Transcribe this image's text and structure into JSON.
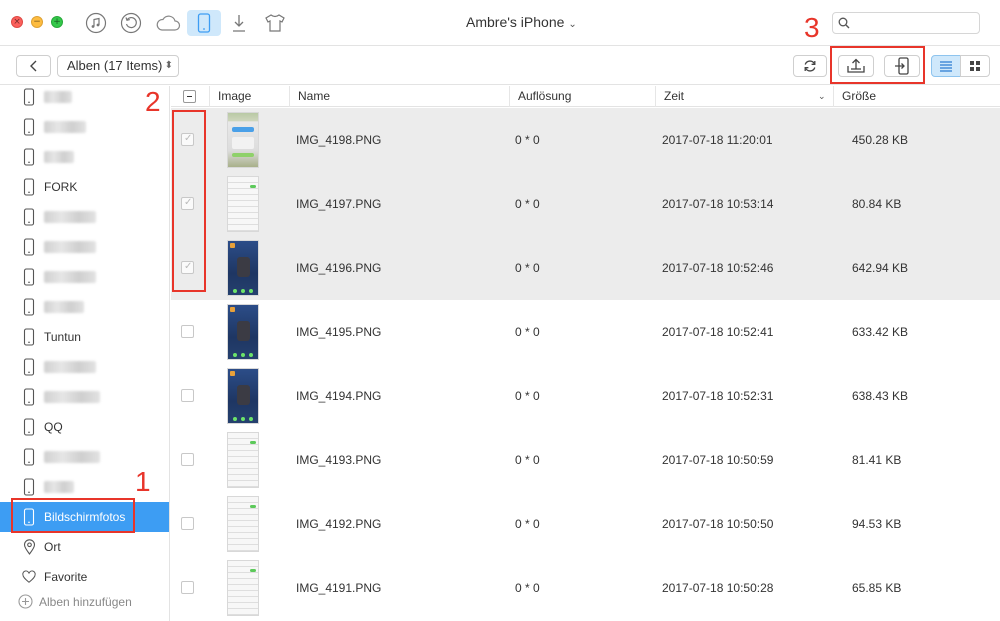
{
  "window": {
    "device_title": "Ambre's iPhone",
    "search_placeholder": ""
  },
  "toolbar": {
    "album_selector": "Alben (17 Items)"
  },
  "annotations": {
    "n1": "1",
    "n2": "2",
    "n3": "3"
  },
  "sidebar": {
    "items": [
      {
        "label": "",
        "blurred": true
      },
      {
        "label": "",
        "blurred": true
      },
      {
        "label": "",
        "blurred": true
      },
      {
        "label": "FORK",
        "blurred": false
      },
      {
        "label": "",
        "blurred": true
      },
      {
        "label": "",
        "blurred": true
      },
      {
        "label": "",
        "blurred": true
      },
      {
        "label": "",
        "blurred": true
      },
      {
        "label": "Tuntun",
        "blurred": false
      },
      {
        "label": "",
        "blurred": true
      },
      {
        "label": "",
        "blurred": true
      },
      {
        "label": "QQ",
        "blurred": false
      },
      {
        "label": "",
        "blurred": true
      },
      {
        "label": "",
        "blurred": true
      },
      {
        "label": "Bildschirmfotos",
        "selected": true
      },
      {
        "label": "Ort",
        "icon": "location-pin-icon"
      },
      {
        "label": "Favorite",
        "icon": "heart-icon"
      }
    ],
    "add_album": "Alben hinzufügen"
  },
  "table": {
    "columns": [
      "Image",
      "Name",
      "Auflösung",
      "Zeit",
      "Größe"
    ],
    "rows": [
      {
        "name": "IMG_4198.PNG",
        "resolution": "0 * 0",
        "time": "2017-07-18 11:20:01",
        "size": "450.28 KB",
        "selected": true
      },
      {
        "name": "IMG_4197.PNG",
        "resolution": "0 * 0",
        "time": "2017-07-18 10:53:14",
        "size": "80.84 KB",
        "selected": true
      },
      {
        "name": "IMG_4196.PNG",
        "resolution": "0 * 0",
        "time": "2017-07-18 10:52:46",
        "size": "642.94 KB",
        "selected": true
      },
      {
        "name": "IMG_4195.PNG",
        "resolution": "0 * 0",
        "time": "2017-07-18 10:52:41",
        "size": "633.42 KB",
        "selected": false
      },
      {
        "name": "IMG_4194.PNG",
        "resolution": "0 * 0",
        "time": "2017-07-18 10:52:31",
        "size": "638.43 KB",
        "selected": false
      },
      {
        "name": "IMG_4193.PNG",
        "resolution": "0 * 0",
        "time": "2017-07-18 10:50:59",
        "size": "81.41 KB",
        "selected": false
      },
      {
        "name": "IMG_4192.PNG",
        "resolution": "0 * 0",
        "time": "2017-07-18 10:50:50",
        "size": "94.53 KB",
        "selected": false
      },
      {
        "name": "IMG_4191.PNG",
        "resolution": "0 * 0",
        "time": "2017-07-18 10:50:28",
        "size": "65.85 KB",
        "selected": false
      }
    ]
  },
  "colors": {
    "accent": "#3d9df3",
    "annotation_red": "#e8352a",
    "selected_row": "#ececec"
  }
}
